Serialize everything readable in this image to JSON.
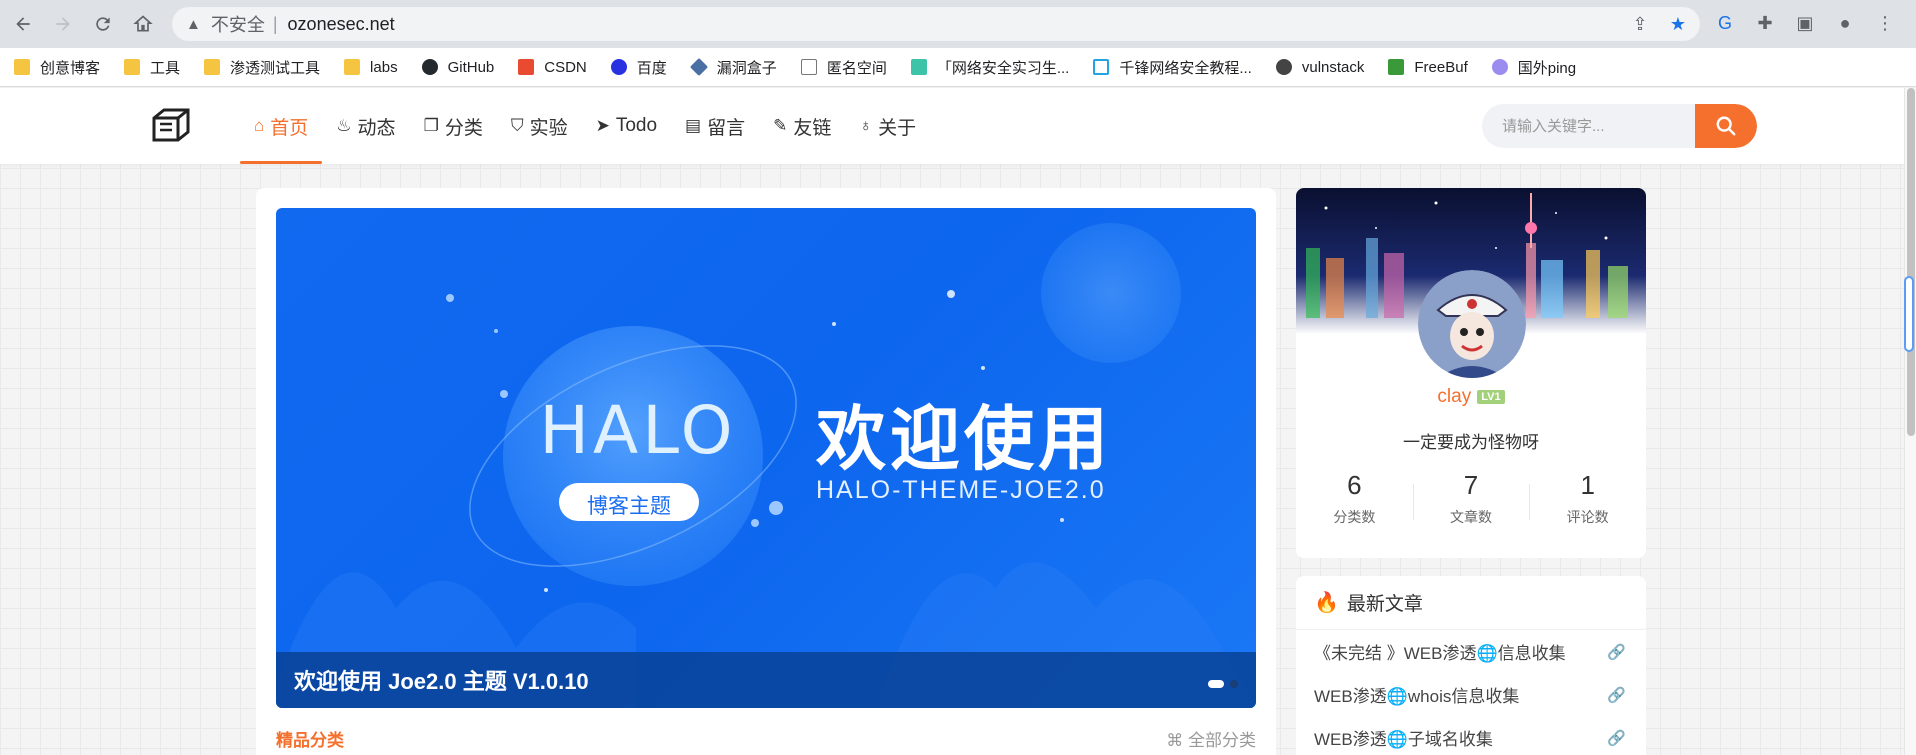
{
  "browser": {
    "security_label": "不安全",
    "separator": "|",
    "url": "ozonesec.net",
    "accent_color": "#1a73e8"
  },
  "bookmarks": [
    {
      "label": "创意博客",
      "icon": "folder-icon"
    },
    {
      "label": "工具",
      "icon": "folder-icon"
    },
    {
      "label": "渗透测试工具",
      "icon": "folder-icon"
    },
    {
      "label": "labs",
      "icon": "folder-icon"
    },
    {
      "label": "GitHub",
      "icon": "github-icon"
    },
    {
      "label": "CSDN",
      "icon": "csdn-icon"
    },
    {
      "label": "百度",
      "icon": "baidu-icon"
    },
    {
      "label": "漏洞盒子",
      "icon": "vulbox-icon"
    },
    {
      "label": "匿名空间",
      "icon": "page-icon"
    },
    {
      "label": "「网络安全实习生...",
      "icon": "b-icon"
    },
    {
      "label": "千锋网络安全教程...",
      "icon": "bilibili-icon"
    },
    {
      "label": "vulnstack",
      "icon": "globe-icon"
    },
    {
      "label": "FreeBuf",
      "icon": "freebuf-icon"
    },
    {
      "label": "国外ping",
      "icon": "k-icon"
    }
  ],
  "nav": {
    "items": [
      {
        "label": "首页",
        "icon": "home-icon",
        "active": true
      },
      {
        "label": "动态",
        "icon": "flame-icon"
      },
      {
        "label": "分类",
        "icon": "book-icon"
      },
      {
        "label": "实验",
        "icon": "shield-icon"
      },
      {
        "label": "Todo",
        "icon": "send-icon"
      },
      {
        "label": "留言",
        "icon": "message-icon"
      },
      {
        "label": "友链",
        "icon": "feather-icon"
      },
      {
        "label": "关于",
        "icon": "bulb-icon"
      }
    ],
    "search_placeholder": "请输入关键字...",
    "accent_color": "#f5702d"
  },
  "banner": {
    "logo_text": "HALO",
    "pill_text": "博客主题",
    "headline": "欢迎使用",
    "subline": "HALO-THEME-JOE2.0",
    "caption": "欢迎使用 Joe2.0 主题  V1.0.10",
    "slide_count": 2,
    "active_slide": 1
  },
  "categories": {
    "title": "精品分类",
    "all_label": "全部分类"
  },
  "profile": {
    "name": "clay",
    "level": "LV1",
    "motto": "一定要成为怪物呀",
    "stats": [
      {
        "value": "6",
        "label": "分类数"
      },
      {
        "value": "7",
        "label": "文章数"
      },
      {
        "value": "1",
        "label": "评论数"
      }
    ]
  },
  "recent": {
    "title": "最新文章",
    "items": [
      "《未完结 》WEB渗透🌐信息收集",
      "WEB渗透🌐whois信息收集",
      "WEB渗透🌐子域名收集"
    ]
  }
}
